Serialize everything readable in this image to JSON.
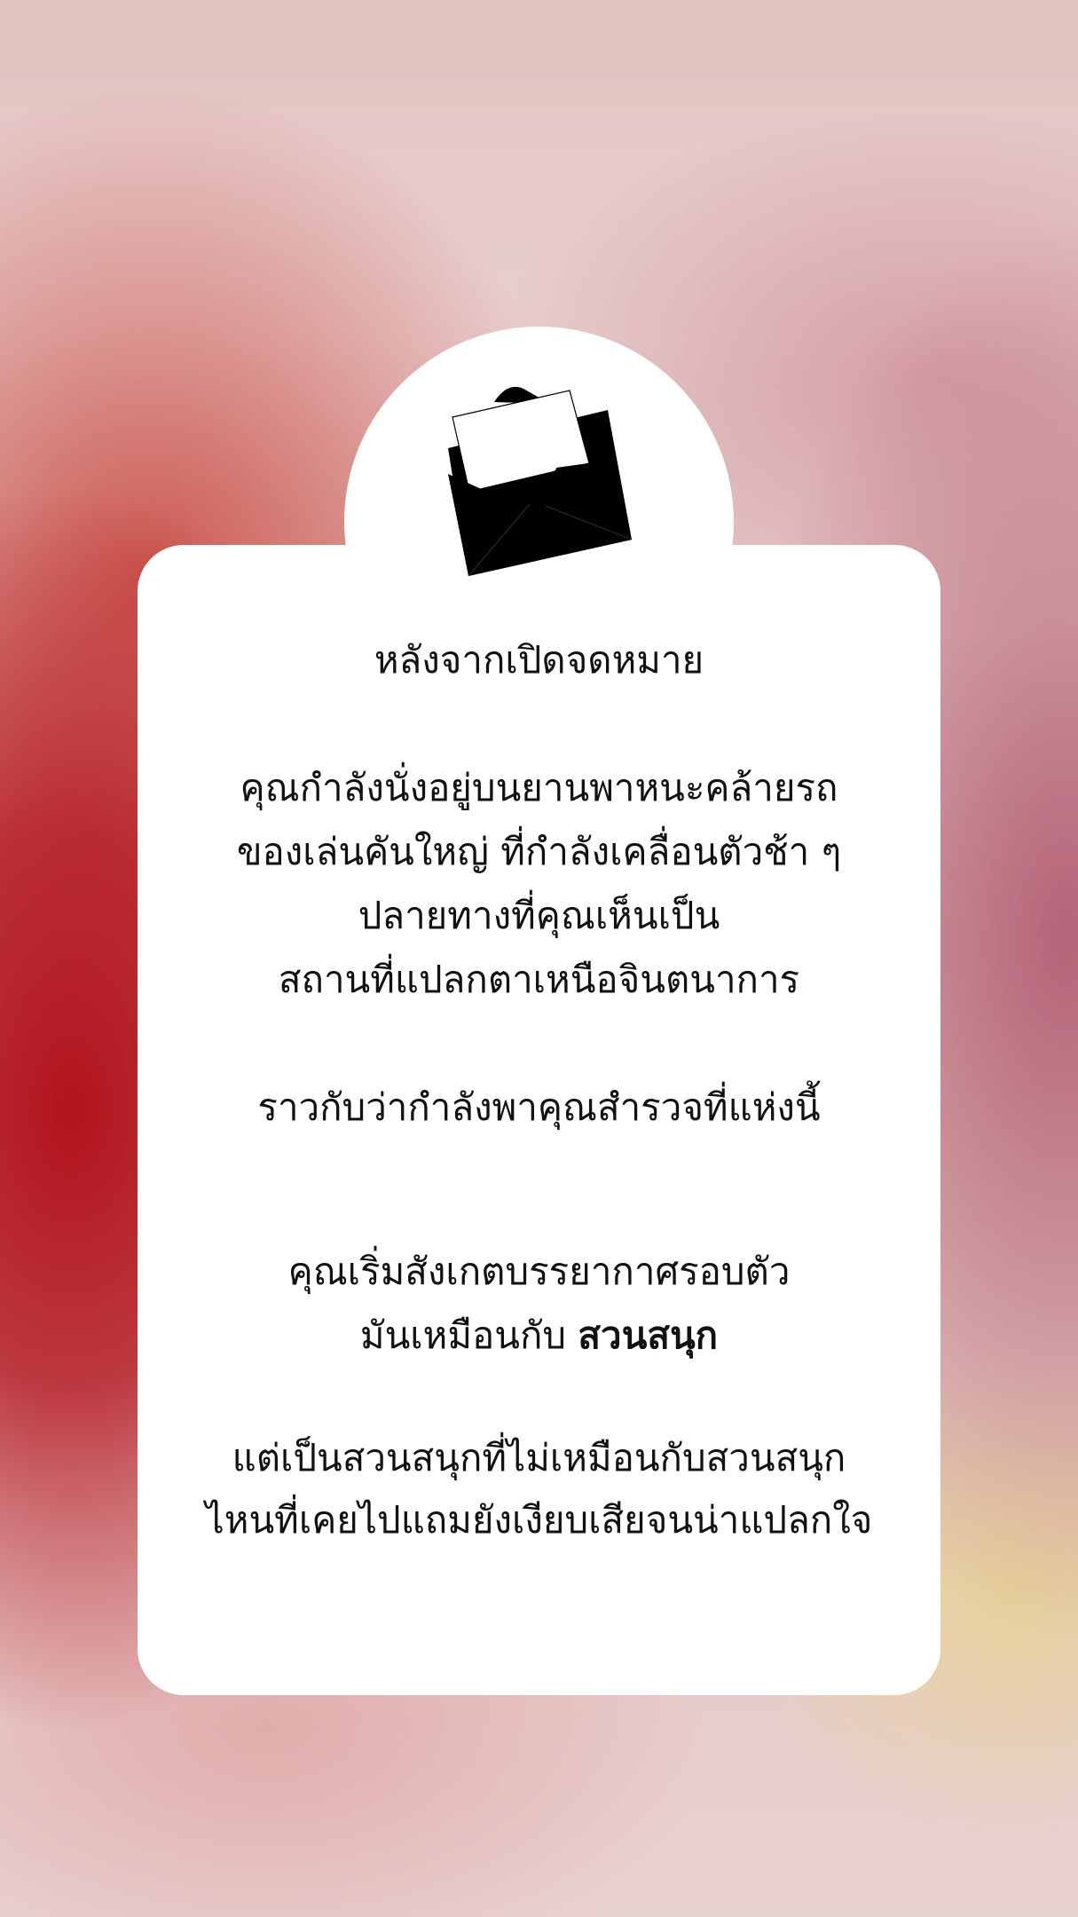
{
  "letter": {
    "title": "หลังจากเปิดจดหมาย",
    "paragraph1": [
      "คุณกำลังนั่งอยู่บนยานพาหนะคล้ายรถ",
      "ของเล่นคันใหญ่ ที่กำลังเคลื่อนตัวช้า ๆ",
      "ปลายทางที่คุณเห็นเป็น",
      "สถานที่แปลกตาเหนือจินตนาการ"
    ],
    "paragraph2": "ราวกับว่ากำลังพาคุณสำรวจที่แห่งนี้",
    "paragraph3": {
      "line1": "คุณเริ่มสังเกตบรรยากาศรอบตัว",
      "line2_prefix": "มันเหมือนกับ ",
      "line2_bold": "สวนสนุก"
    },
    "paragraph4": [
      "แต่เป็นสวนสนุกที่ไม่เหมือนกับสวนสนุก",
      "ไหนที่เคยไปแถมยังเงียบเสียจนน่าแปลกใจ"
    ]
  },
  "icons": {
    "header_icon": "open-envelope-icon"
  },
  "colors": {
    "card": "#ffffff",
    "text": "#111111",
    "icon": "#000000",
    "accent_red": "#b00a14"
  }
}
